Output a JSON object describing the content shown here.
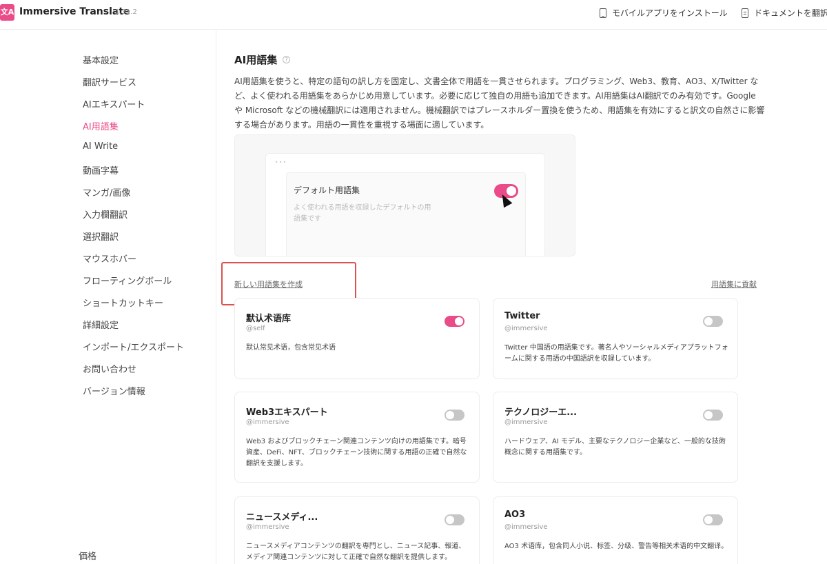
{
  "header": {
    "logo_text": "文A",
    "app_name": "Immersive Translate",
    "version": "1.31.2",
    "install_app": "モバイルアプリをインストール",
    "docs": "ドキュメントを翻訳"
  },
  "sidebar": {
    "items": [
      {
        "label": "基本設定"
      },
      {
        "label": "翻訳サービス"
      },
      {
        "label": "AIエキスパート"
      },
      {
        "label": "AI用語集"
      },
      {
        "label": "AI Write"
      },
      {
        "label": "動画字幕"
      },
      {
        "label": "マンガ/画像"
      },
      {
        "label": "入力欄翻訳"
      },
      {
        "label": "選択翻訳"
      },
      {
        "label": "マウスホバー"
      },
      {
        "label": "フローティングボール"
      },
      {
        "label": "ショートカットキー"
      },
      {
        "label": "詳細設定"
      },
      {
        "label": "インポート/エクスポート"
      },
      {
        "label": "お問い合わせ"
      },
      {
        "label": "バージョン情報"
      }
    ],
    "active_index": 3,
    "price": "価格"
  },
  "main": {
    "title": "AI用語集",
    "description": "AI用語集を使うと、特定の語句の訳し方を固定し、文書全体で用語を一貫させられます。プログラミング、Web3、教育、AO3、X/Twitter など、よく使われる用語集をあらかじめ用意しています。必要に応じて独自の用語も追加できます。AI用語集はAI翻訳でのみ有効です。Google や Microsoft などの機械翻訳には適用されません。機械翻訳ではプレースホルダー置換を使うため、用語集を有効にすると訳文の自然さに影響する場合があります。用語の一貫性を重視する場面に適しています。",
    "preview": {
      "dots": "•••",
      "card_title": "デフォルト用語集",
      "card_desc": "よく使われる用語を収録したデフォルトの用語集です",
      "toggle_on": true
    },
    "create_link": "新しい用語集を作成",
    "contribute_link": "用語集に貢献",
    "cards": [
      {
        "title": "默认术语库",
        "handle": "@self",
        "desc": "默认常见术语，包含常见术语",
        "on": true
      },
      {
        "title": "Twitter",
        "handle": "@immersive",
        "desc": "Twitter 中国語の用語集です。著名人やソーシャルメディアプラットフォームに関する用語の中国語訳を収録しています。",
        "on": false
      },
      {
        "title": "Web3エキスパート",
        "handle": "@immersive",
        "desc": "Web3 およびブロックチェーン関連コンテンツ向けの用語集です。暗号資産、DeFi、NFT、ブロックチェーン技術に関する用語の正確で自然な翻訳を支援します。",
        "on": false
      },
      {
        "title": "テクノロジーエ...",
        "handle": "@immersive",
        "desc": "ハードウェア、AI モデル、主要なテクノロジー企業など、一般的な技術概念に関する用語集です。",
        "on": false
      },
      {
        "title": "ニュースメディ...",
        "handle": "@immersive",
        "desc": "ニュースメディアコンテンツの翻訳を専門とし、ニュース記事、報道、メディア関連コンテンツに対して正確で自然な翻訳を提供します。",
        "on": false
      },
      {
        "title": "AO3",
        "handle": "@immersive",
        "desc": "AO3 术语库，包含同人小说、标签、分级、警告等相关术语的中文翻译。",
        "on": false
      }
    ]
  },
  "colors": {
    "accent": "#ea4c89",
    "highlight_box": "#d9534f"
  }
}
